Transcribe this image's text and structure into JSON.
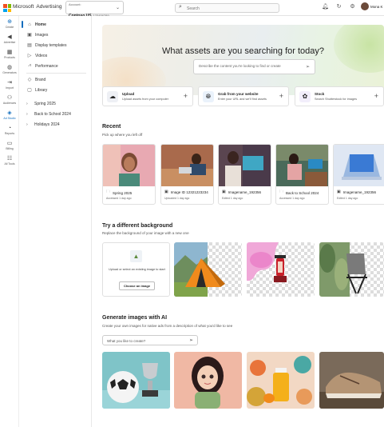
{
  "header": {
    "brand": "Microsoft",
    "product": "Advertising",
    "account_label": "Account:",
    "account_name": "Contoso US",
    "account_number": "123456789",
    "search_placeholder": "Search",
    "user_name": "Mona K"
  },
  "rail": [
    {
      "label": "Create",
      "icon": "plus-circle-icon"
    },
    {
      "label": "Advertise",
      "icon": "megaphone-icon"
    },
    {
      "label": "Products",
      "icon": "products-icon"
    },
    {
      "label": "Generators",
      "icon": "generators-icon"
    },
    {
      "label": "Import",
      "icon": "import-icon"
    },
    {
      "label": "Audiences",
      "icon": "audiences-icon"
    },
    {
      "label": "Ad Studio",
      "icon": "ad-studio-icon"
    },
    {
      "label": "Reports",
      "icon": "reports-icon"
    },
    {
      "label": "Billing",
      "icon": "billing-icon"
    },
    {
      "label": "All Tools",
      "icon": "tools-icon"
    }
  ],
  "nav": {
    "items": [
      {
        "label": "Home",
        "icon": "home-icon"
      },
      {
        "label": "Images",
        "icon": "images-icon"
      },
      {
        "label": "Display templates",
        "icon": "templates-icon"
      },
      {
        "label": "Videos",
        "icon": "videos-icon"
      },
      {
        "label": "Performance",
        "icon": "performance-icon"
      }
    ],
    "library": [
      {
        "label": "Brand",
        "icon": "brand-icon"
      },
      {
        "label": "Library",
        "icon": "library-icon"
      }
    ],
    "folders": [
      "Spring 2025",
      "Back to School 2024",
      "Holidays 2024"
    ]
  },
  "hero": {
    "title": "What assets are you searching for today?",
    "placeholder": "Describe the content you're looking to find or create"
  },
  "actions": [
    {
      "title": "Upload",
      "subtitle": "Upload assets from your computer"
    },
    {
      "title": "Grab from your website",
      "subtitle": "Enter your URL and we'll find assets"
    },
    {
      "title": "Stock",
      "subtitle": "Search Shutterstock for images"
    }
  ],
  "recent": {
    "title": "Recent",
    "subtitle": "Pick up where you left off",
    "items": [
      {
        "name": "Spring 2025",
        "meta": "Accessed 1 day ago",
        "type": "folder"
      },
      {
        "name": "Image ID 12321223234",
        "meta": "Uploaded 1 day ago",
        "type": "image"
      },
      {
        "name": "Imagename_192356",
        "meta": "Edited 1 day ago",
        "type": "image"
      },
      {
        "name": "Back to School 2024",
        "meta": "Accessed 1 day ago",
        "type": "folder"
      },
      {
        "name": "Imagename_192356",
        "meta": "Edited 1 day ago",
        "type": "image"
      }
    ]
  },
  "background": {
    "title": "Try a different background",
    "subtitle": "Replace the background of your image with a new one",
    "upload_text": "Upload or select an existing image to start",
    "upload_button": "Choose an image"
  },
  "generate": {
    "title": "Generate images with AI",
    "subtitle": "Create your own images for native ads from a description of what you'd like to see",
    "placeholder": "What you like to create?"
  },
  "colors": {
    "accent": "#0f6cbd",
    "ms_red": "#f25022",
    "ms_green": "#7fba00",
    "ms_blue": "#00a4ef",
    "ms_yellow": "#ffb900"
  }
}
